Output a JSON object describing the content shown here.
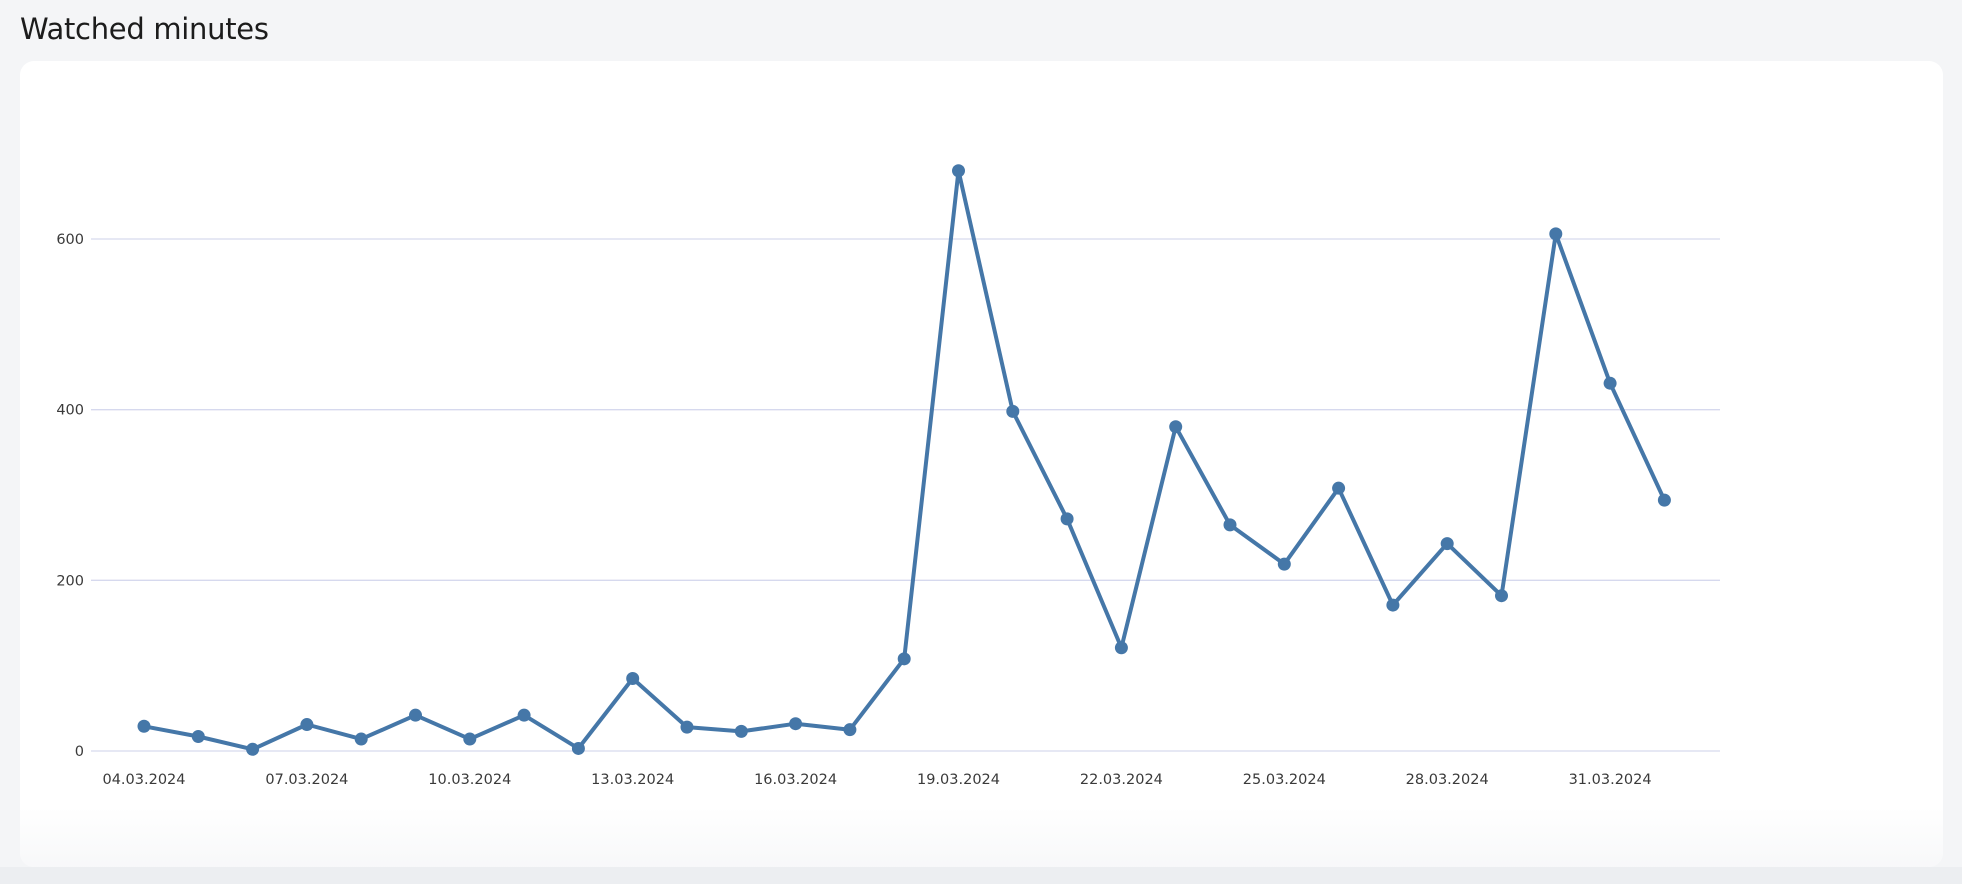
{
  "page": {
    "title": "Watched minutes"
  },
  "chart_data": {
    "type": "line",
    "title": "Watched minutes",
    "xlabel": "",
    "ylabel": "",
    "ylim": [
      0,
      700
    ],
    "y_ticks": [
      0,
      200,
      400,
      600
    ],
    "x_tick_labels": [
      "04.03.2024",
      "07.03.2024",
      "10.03.2024",
      "13.03.2024",
      "16.03.2024",
      "19.03.2024",
      "22.03.2024",
      "25.03.2024",
      "28.03.2024",
      "31.03.2024"
    ],
    "x": [
      "04.03.2024",
      "05.03.2024",
      "06.03.2024",
      "07.03.2024",
      "08.03.2024",
      "09.03.2024",
      "10.03.2024",
      "11.03.2024",
      "12.03.2024",
      "13.03.2024",
      "14.03.2024",
      "15.03.2024",
      "16.03.2024",
      "17.03.2024",
      "18.03.2024",
      "19.03.2024",
      "20.03.2024",
      "21.03.2024",
      "22.03.2024",
      "23.03.2024",
      "24.03.2024",
      "25.03.2024",
      "26.03.2024",
      "27.03.2024",
      "28.03.2024",
      "29.03.2024",
      "30.03.2024",
      "31.03.2024",
      "01.04.2024"
    ],
    "series": [
      {
        "values": [
          29,
          17,
          2,
          31,
          14,
          42,
          14,
          42,
          3,
          85,
          28,
          23,
          32,
          25,
          108,
          680,
          398,
          272,
          121,
          380,
          265,
          219,
          308,
          171,
          243,
          182,
          606,
          431,
          294
        ]
      }
    ],
    "grid": true,
    "legend": "none",
    "colors": {
      "line": "#4577a8",
      "grid": "#d6d9ee",
      "axis_text": "#3a3a3a"
    }
  }
}
